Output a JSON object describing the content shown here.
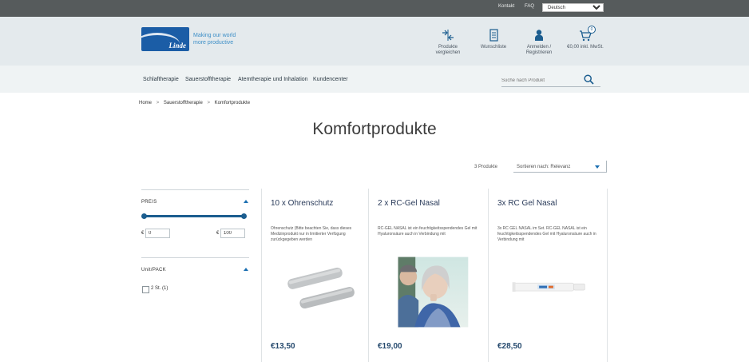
{
  "topbar": {
    "links": [
      "Kontakt",
      "FAQ"
    ],
    "language": "Deutsch"
  },
  "header": {
    "logo_text": "Linde",
    "tagline": [
      "Making our world",
      "more productive"
    ],
    "icons": [
      {
        "name": "compare-icon",
        "label": "Produkte vergleichen"
      },
      {
        "name": "wishlist-icon",
        "label": "Wunschliste"
      },
      {
        "name": "user-icon",
        "label": "Anmelden / Registrieren"
      },
      {
        "name": "cart-icon",
        "label": "€0,00 inkl. MwSt."
      }
    ],
    "cart_count": "0"
  },
  "nav": {
    "items": [
      "Schlaftherapie",
      "Sauerstofftherapie",
      "Atemtherapie und Inhalation",
      "Kundencenter"
    ],
    "search_placeholder": "Suche nach Produkt"
  },
  "breadcrumb": [
    "Home",
    "Sauerstofftherapie",
    "Komfortprodukte"
  ],
  "page_title": "Komfortprodukte",
  "toolbar": {
    "count": "3 Produkte",
    "sort_label": "Sortieren nach: Relevanz"
  },
  "filters": {
    "price": {
      "heading": "PREIS",
      "min_label": "€",
      "min_value": "0",
      "max_label": "€",
      "max_value": "100"
    },
    "unit": {
      "heading": "Unit/PACK",
      "option": "2 St. (1)"
    }
  },
  "products": [
    {
      "title": "10 x Ohrenschutz",
      "description": "Ohrenschutz (Bitte beachten Sie, dass dieses Medizinprodukt nur in limitierter Verfügung zurückgegeben werden",
      "price": "€13,50"
    },
    {
      "title": "2 x RC-Gel Nasal",
      "description": "RC-GEL NASAL ist ein feuchtigkeitsspendendes Gel mit Hyaluronsäure auch in Verbindung mit",
      "price": "€19,00"
    },
    {
      "title": "3x RC Gel Nasal",
      "description": "3x RC GEL NASAL im Set. RC-GEL NASAL ist ein feuchtigkeitsspendendes Gel mit Hyaluronsäure auch in Verbindung mit",
      "price": "€28,50"
    }
  ]
}
